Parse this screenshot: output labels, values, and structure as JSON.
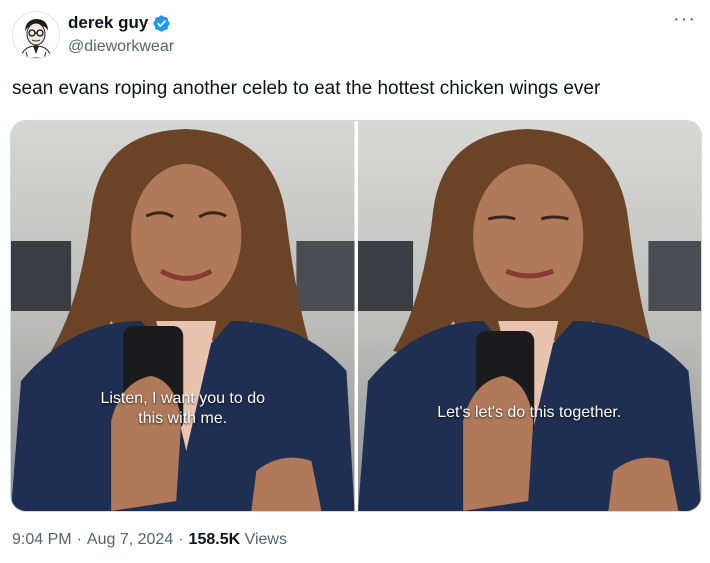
{
  "author": {
    "display_name": "derek guy",
    "handle": "@dieworkwear",
    "verified_icon": "verified-badge-icon",
    "accent_color": "#1d9bf0"
  },
  "tweet": {
    "text": "sean evans roping another celeb to eat the hottest chicken wings ever",
    "media": [
      {
        "caption_line1": "Listen, I want you to do",
        "caption_line2": "this with me."
      },
      {
        "caption_line1": "Let's let's do this together.",
        "caption_line2": ""
      }
    ]
  },
  "meta": {
    "time": "9:04 PM",
    "date": "Aug 7, 2024",
    "views_count": "158.5K",
    "views_label": "Views"
  },
  "more_icon": "more-horizontal-icon"
}
